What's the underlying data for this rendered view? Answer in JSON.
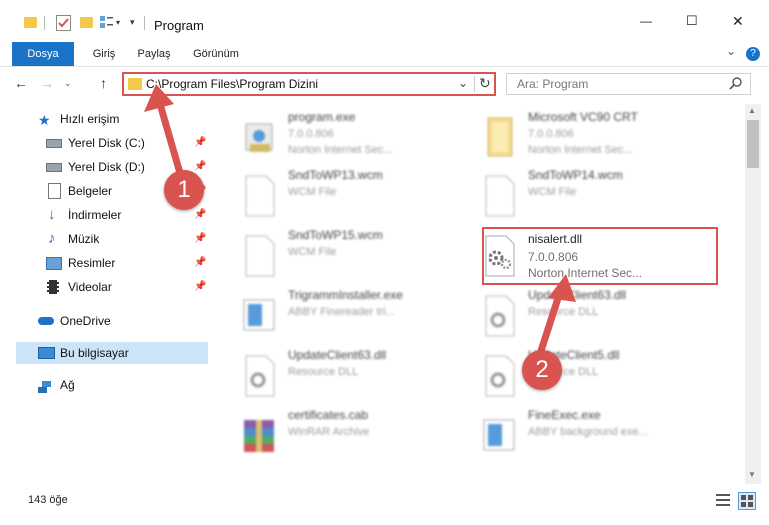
{
  "window": {
    "title": "Program",
    "minimize_glyph": "—",
    "maximize_glyph": "☐",
    "close_glyph": "✕"
  },
  "ribbon": {
    "tabs": [
      "Dosya",
      "Giriş",
      "Paylaş",
      "Görünüm"
    ],
    "expand_glyph": "⌄",
    "help_glyph": "?"
  },
  "address": {
    "path": "C:\\Program Files\\Program Dizini",
    "search_placeholder": "Ara: Program"
  },
  "nav_pane": {
    "items": [
      {
        "label": "Hızlı erişim",
        "icon": "star-icon",
        "pinned": false
      },
      {
        "label": "Yerel Disk (C:)",
        "icon": "drive-icon",
        "pinned": true
      },
      {
        "label": "Yerel Disk (D:)",
        "icon": "drive-icon",
        "pinned": true
      },
      {
        "label": "Belgeler",
        "icon": "document-icon",
        "pinned": true
      },
      {
        "label": "İndirmeler",
        "icon": "download-icon",
        "pinned": true
      },
      {
        "label": "Müzik",
        "icon": "music-icon",
        "pinned": true
      },
      {
        "label": "Resimler",
        "icon": "pictures-icon",
        "pinned": true
      },
      {
        "label": "Videolar",
        "icon": "video-icon",
        "pinned": true
      },
      {
        "label": "OneDrive",
        "icon": "cloud-icon",
        "pinned": false
      },
      {
        "label": "Bu bilgisayar",
        "icon": "computer-icon",
        "pinned": false,
        "selected": true
      },
      {
        "label": "Ağ",
        "icon": "network-icon",
        "pinned": false
      }
    ],
    "pin_glyph": "📌"
  },
  "files": [
    {
      "name": "program.exe",
      "line1": "7.0.0.806",
      "line2": "Norton Internet Sec...",
      "icon": "setup-icon"
    },
    {
      "name": "Microsoft VC90 CRT",
      "line1": "7.0.0.806",
      "line2": "Norton Internet Sec...",
      "icon": "folder-icon"
    },
    {
      "name": "SndToWP13.wcm",
      "line1": "WCM File",
      "line2": "",
      "icon": "blank-file-icon"
    },
    {
      "name": "SndToWP14.wcm",
      "line1": "WCM File",
      "line2": "",
      "icon": "blank-file-icon"
    },
    {
      "name": "SndToWP15.wcm",
      "line1": "WCM File",
      "line2": "",
      "icon": "blank-file-icon"
    },
    {
      "name": "nisalert.dll",
      "line1": "7.0.0.806",
      "line2": "Norton Internet Sec...",
      "icon": "dll-gear-icon"
    },
    {
      "name": "TrigrammInstaller.exe",
      "line1": "ABBY Finereader tri...",
      "line2": "",
      "icon": "installer-icon"
    },
    {
      "name": "UpdateClient63.dll",
      "line1": "Resource DLL",
      "line2": "",
      "icon": "dll-gear-icon"
    },
    {
      "name": "UpdateClient63.dll",
      "line1": "Resource DLL",
      "line2": "",
      "icon": "dll-gear-icon"
    },
    {
      "name": "UpdateClient5.dll",
      "line1": "Resource DLL",
      "line2": "",
      "icon": "dll-gear-icon"
    },
    {
      "name": "certificates.cab",
      "line1": "WinRAR Archive",
      "line2": "",
      "icon": "archive-icon"
    },
    {
      "name": "FineExec.exe",
      "line1": "ABBY background exe...",
      "line2": "",
      "icon": "installer-icon"
    }
  ],
  "status": {
    "item_count": "143 öğe"
  },
  "annotations": [
    "1",
    "2"
  ],
  "colors": {
    "accent": "#1a73c7",
    "highlight_box": "#d9534f",
    "selected_nav": "#cce4f7"
  }
}
